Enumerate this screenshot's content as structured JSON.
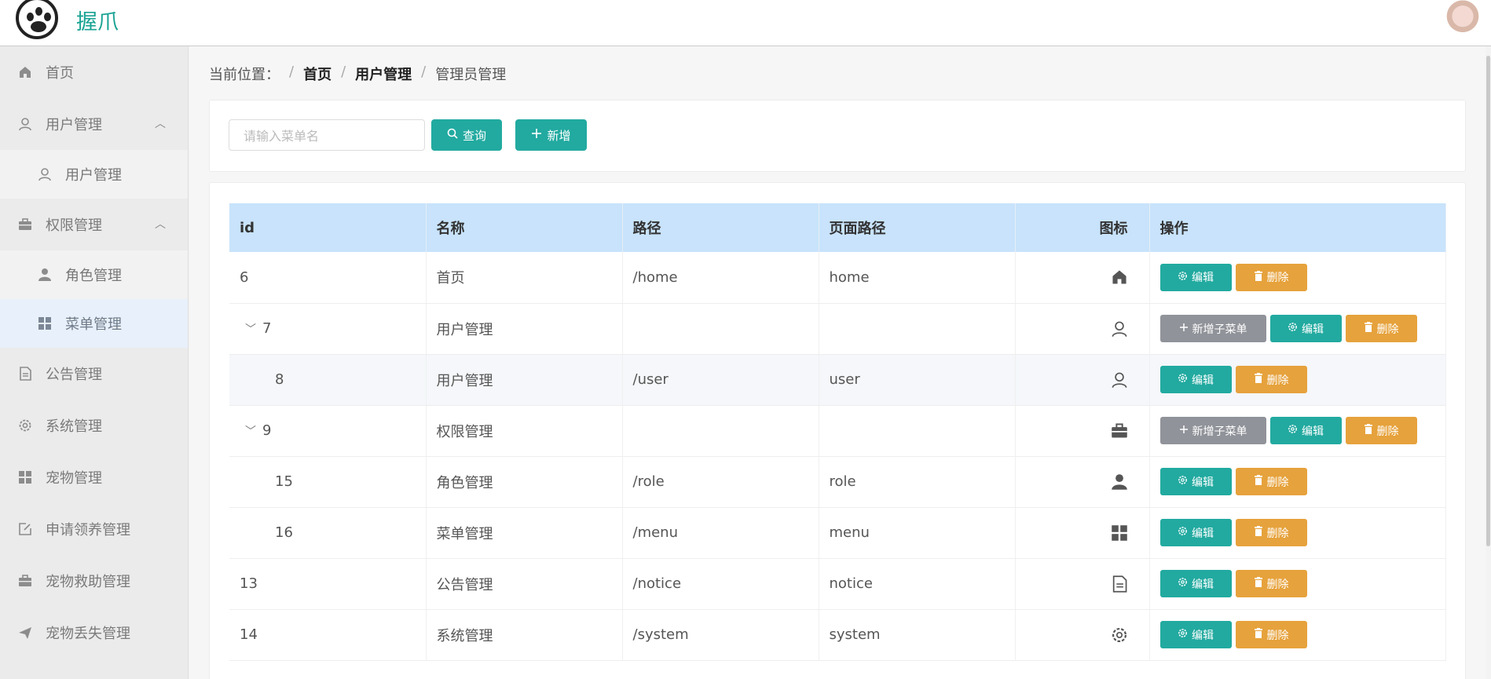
{
  "header": {
    "brand": "握爪"
  },
  "sidebar": {
    "items": [
      {
        "label": "首页",
        "icon": "home-icon"
      },
      {
        "label": "用户管理",
        "icon": "user-icon",
        "expanded": true,
        "children": [
          {
            "label": "用户管理",
            "icon": "user-icon"
          }
        ]
      },
      {
        "label": "权限管理",
        "icon": "briefcase-icon",
        "expanded": true,
        "children": [
          {
            "label": "角色管理",
            "icon": "avatar-icon"
          },
          {
            "label": "菜单管理",
            "icon": "grid-icon",
            "active": true
          }
        ]
      },
      {
        "label": "公告管理",
        "icon": "document-icon"
      },
      {
        "label": "系统管理",
        "icon": "gear-icon"
      },
      {
        "label": "宠物管理",
        "icon": "grid-icon"
      },
      {
        "label": "申请领养管理",
        "icon": "edit-icon"
      },
      {
        "label": "宠物救助管理",
        "icon": "briefcase-icon"
      },
      {
        "label": "宠物丢失管理",
        "icon": "send-icon"
      }
    ]
  },
  "breadcrumb": {
    "prefix": "当前位置：",
    "sep": "/",
    "home": "首页",
    "parent": "用户管理",
    "current": "管理员管理"
  },
  "search": {
    "placeholder": "请输入菜单名",
    "query_label": "查询",
    "add_label": "新增"
  },
  "table": {
    "columns": [
      "id",
      "名称",
      "路径",
      "页面路径",
      "图标",
      "操作"
    ],
    "rows": [
      {
        "id": "6",
        "name": "首页",
        "path": "/home",
        "page": "home",
        "icon": "home-icon",
        "level": 0,
        "has_children": false
      },
      {
        "id": "7",
        "name": "用户管理",
        "path": "",
        "page": "",
        "icon": "user-icon",
        "level": 0,
        "has_children": true
      },
      {
        "id": "8",
        "name": "用户管理",
        "path": "/user",
        "page": "user",
        "icon": "user-icon",
        "level": 1,
        "has_children": false
      },
      {
        "id": "9",
        "name": "权限管理",
        "path": "",
        "page": "",
        "icon": "briefcase-icon",
        "level": 0,
        "has_children": true
      },
      {
        "id": "15",
        "name": "角色管理",
        "path": "/role",
        "page": "role",
        "icon": "avatar-icon",
        "level": 1,
        "has_children": false
      },
      {
        "id": "16",
        "name": "菜单管理",
        "path": "/menu",
        "page": "menu",
        "icon": "grid-icon",
        "level": 1,
        "has_children": false
      },
      {
        "id": "13",
        "name": "公告管理",
        "path": "/notice",
        "page": "notice",
        "icon": "document-icon",
        "level": 0,
        "has_children": false
      },
      {
        "id": "14",
        "name": "系统管理",
        "path": "/system",
        "page": "system",
        "icon": "gear-icon",
        "level": 0,
        "has_children": false
      }
    ],
    "ops": {
      "add_sub": "新增子菜单",
      "edit": "编辑",
      "delete": "删除"
    }
  },
  "colors": {
    "accent": "#22aaa0",
    "warning": "#e6a23c",
    "info": "#909399",
    "header_bg": "#c8e3fb"
  }
}
